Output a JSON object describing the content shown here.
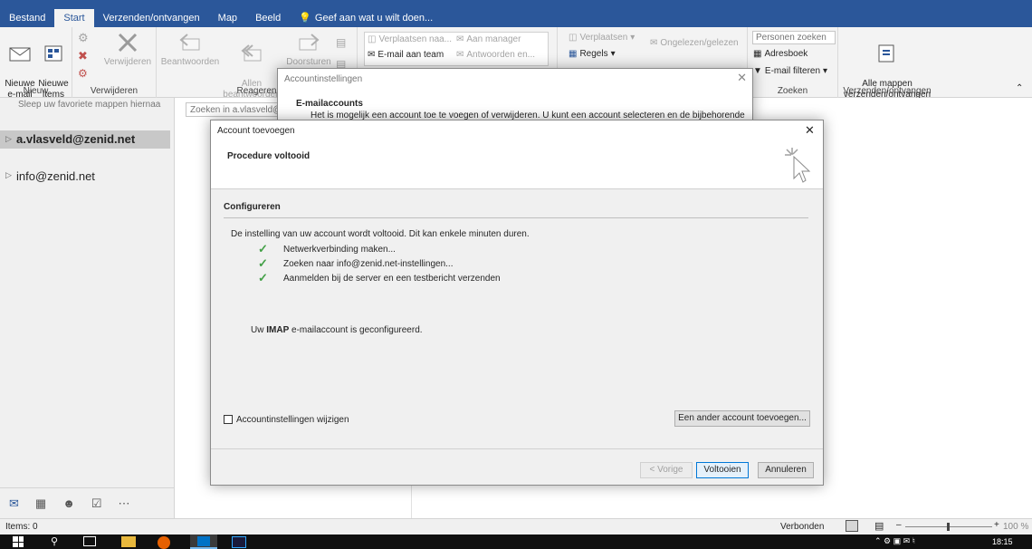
{
  "tabs": [
    "Bestand",
    "Start",
    "Verzenden/ontvangen",
    "Map",
    "Beeld"
  ],
  "tell_me": "Geef aan wat u wilt doen...",
  "ribbon": {
    "new_email": "Nieuwe\ne-mail",
    "new_items": "Nieuwe\nitems",
    "group_new": "Nieuw",
    "delete": "Verwijderen",
    "group_delete": "Verwijderen",
    "reply": "Beantwoorden",
    "reply_all": "Allen\nbeantwoorden",
    "forward": "Doorsturen",
    "group_respond": "Reageren",
    "move_to": "Verplaatsen naa...",
    "to_manager": "Aan manager",
    "team_email": "E-mail aan team",
    "reply_delete": "Antwoorden en...",
    "move": "Verplaatsen",
    "rules": "Regels",
    "unread_read": "Ongelezen/gelezen",
    "search_people": "Personen zoeken",
    "address_book": "Adresboek",
    "filter_email": "E-mail filteren",
    "group_find": "Zoeken",
    "send_receive_all": "Alle mappen\nverzenden/ontvangen",
    "group_send_receive": "Verzenden/ontvangen"
  },
  "folder_pane": {
    "drag_hint": "Sleep uw favoriete mappen hiernaa",
    "account1": "a.vlasveld@zenid.net",
    "account2": "info@zenid.net"
  },
  "search_placeholder": "Zoeken in a.vlasveld@",
  "account_settings": {
    "title": "Accountinstellingen",
    "section": "E-mailaccounts",
    "desc": "Het is mogelijk een account toe te voegen of verwijderen. U kunt een account selecteren en de bijbehorende"
  },
  "add_account": {
    "title": "Account toevoegen",
    "heading": "Procedure voltooid",
    "section": "Configureren",
    "intro": "De instelling van uw account wordt voltooid. Dit kan enkele minuten duren.",
    "steps": [
      "Netwerkverbinding maken...",
      "Zoeken naar info@zenid.net-instellingen...",
      "Aanmelden bij de server en een testbericht verzenden"
    ],
    "result_prefix": "Uw ",
    "result_bold": "IMAP",
    "result_suffix": " e-mailaccount is geconfigureerd.",
    "change_settings": "Accountinstellingen wijzigen",
    "add_another": "Een ander account toevoegen...",
    "back": "< Vorige",
    "finish": "Voltooien",
    "cancel": "Annuleren"
  },
  "status": {
    "items": "Items: 0",
    "connected": "Verbonden",
    "zoom": "100 %"
  },
  "clock": "18:15",
  "colors": {
    "accent": "#2b579a",
    "check": "#43a047"
  }
}
